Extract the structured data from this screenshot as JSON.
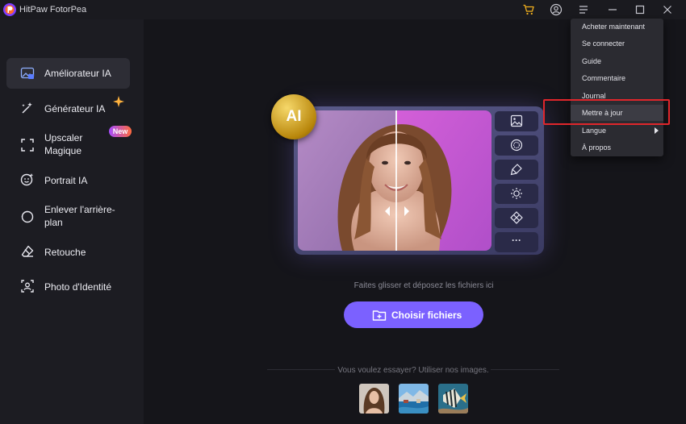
{
  "app": {
    "title": "HitPaw FotorPea"
  },
  "titlebar_icons": [
    "cart-icon",
    "account-icon",
    "menu-icon",
    "minimize-icon",
    "maximize-icon",
    "close-icon"
  ],
  "colors": {
    "accent": "#7b61ff",
    "highlight": "#e0262b",
    "gold": "#d4a017",
    "cart": "#f2b01e"
  },
  "sidebar": {
    "items": [
      {
        "label": "Améliorateur IA",
        "icon": "image-enhance-icon",
        "active": true
      },
      {
        "label": "Générateur IA",
        "icon": "magic-wand-icon"
      },
      {
        "label": "Upscaler Magique",
        "icon": "expand-icon",
        "badge": "New"
      },
      {
        "label": "Portrait IA",
        "icon": "portrait-icon"
      },
      {
        "label": "Enlever l'arrière-plan",
        "icon": "remove-bg-icon"
      },
      {
        "label": "Retouche",
        "icon": "eraser-icon"
      },
      {
        "label": "Photo d'Identité",
        "icon": "id-photo-icon"
      }
    ]
  },
  "hero": {
    "badge": "AI",
    "tools": [
      "image-icon",
      "filter-icon",
      "brush-icon",
      "brightness-icon",
      "shapes-icon",
      "more-icon"
    ],
    "more_label": "···"
  },
  "upload": {
    "drop_text": "Faites glisser et déposez les fichiers ici",
    "choose_label": "Choisir fichiers"
  },
  "samples": {
    "label": "Vous voulez essayer? Utiliser nos images.",
    "items": [
      "sample-portrait",
      "sample-coast",
      "sample-fish"
    ]
  },
  "menu": {
    "items": [
      {
        "label": "Acheter maintenant"
      },
      {
        "label": "Se connecter"
      },
      {
        "label": "Guide"
      },
      {
        "label": "Commentaire"
      },
      {
        "label": "Journal"
      },
      {
        "label": "Mettre à jour",
        "hovered": true
      },
      {
        "label": "Langue",
        "submenu": true
      },
      {
        "label": "À propos"
      }
    ]
  }
}
